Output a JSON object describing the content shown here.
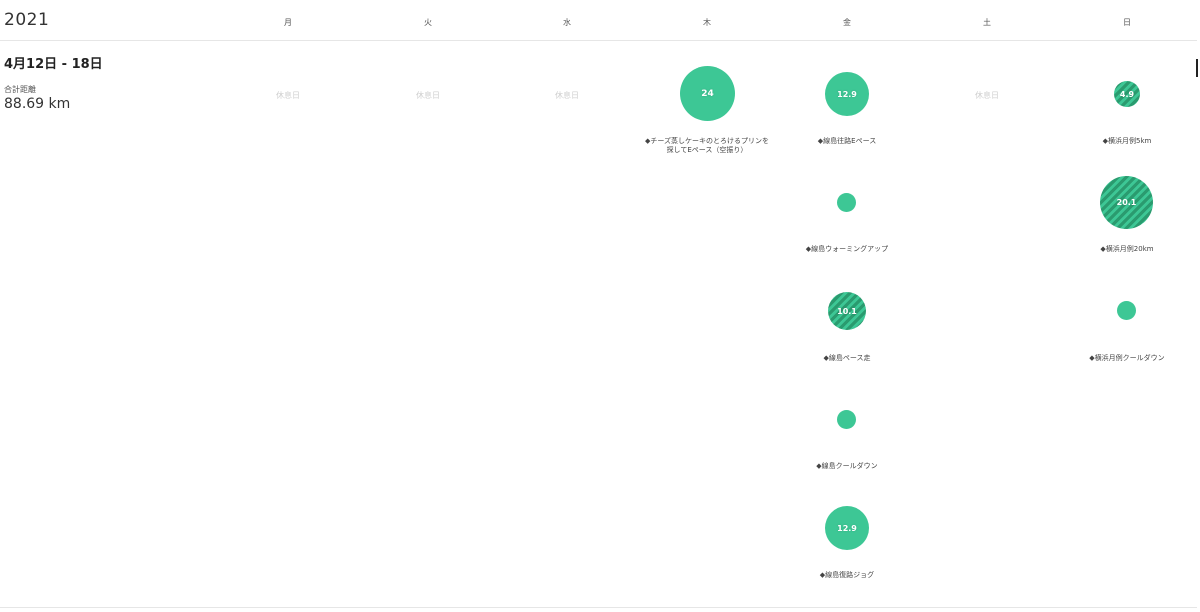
{
  "header": {
    "year": "2021",
    "days": [
      "月",
      "火",
      "水",
      "木",
      "金",
      "土",
      "日"
    ]
  },
  "week": {
    "title": "4月12日 - 18日",
    "total_label": "合計距離",
    "total_value": "88.69 km"
  },
  "rest_label": "休息日",
  "activities": {
    "thu_1": {
      "value": "24",
      "label": "◆チーズ蒸しケーキのとろけるプリンを探してEペース（空振り）"
    },
    "fri_1": {
      "value": "12.9",
      "label": "◆線島往路Eペース"
    },
    "fri_2": {
      "value": "",
      "label": "◆線島ウォーミングアップ"
    },
    "fri_3": {
      "value": "10.1",
      "label": "◆線島ペース走"
    },
    "fri_4": {
      "value": "",
      "label": "◆線島クールダウン"
    },
    "fri_5": {
      "value": "12.9",
      "label": "◆線島復路ジョグ"
    },
    "sun_1": {
      "value": "4.9",
      "label": "◆横浜月例5km"
    },
    "sun_2": {
      "value": "20.1",
      "label": "◆横浜月例20km"
    },
    "sun_3": {
      "value": "",
      "label": "◆横浜月例クールダウン"
    }
  },
  "colors": {
    "bubble": "#3dc795",
    "bubble_stripe": "#2a9b6f",
    "rest_text": "#cfcfcf"
  }
}
